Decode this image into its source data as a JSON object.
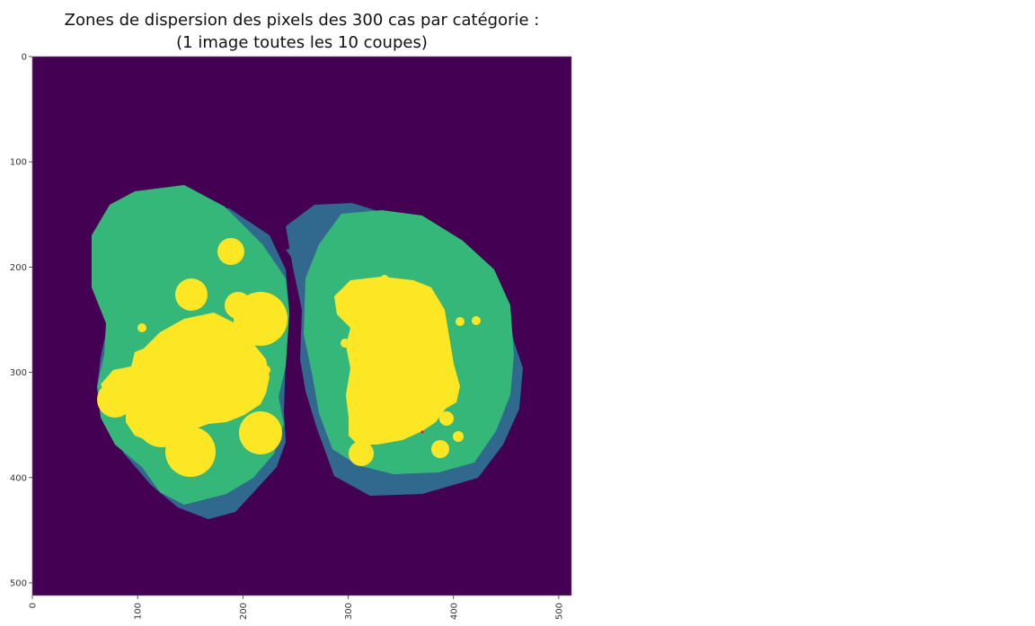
{
  "title_line1": "Zones de dispersion des pixels des 300 cas par catégorie :",
  "title_line2": "(1 image toutes les 10 coupes)",
  "chart_data": {
    "type": "heatmap",
    "title": "Zones de dispersion des pixels des 300 cas par catégorie : (1 image toutes les 10 coupes)",
    "xlim": [
      0,
      512
    ],
    "ylim": [
      512,
      0
    ],
    "x_ticks": [
      "0",
      "100",
      "200",
      "300",
      "400",
      "500"
    ],
    "y_ticks": [
      "0",
      "100",
      "200",
      "300",
      "400",
      "500"
    ],
    "colormap": "viridis",
    "colors": {
      "background": "#440154",
      "outer_zone": "#31688e",
      "middle_zone": "#35b779",
      "inner_zone": "#fde725",
      "marker": "#e0143c"
    }
  }
}
